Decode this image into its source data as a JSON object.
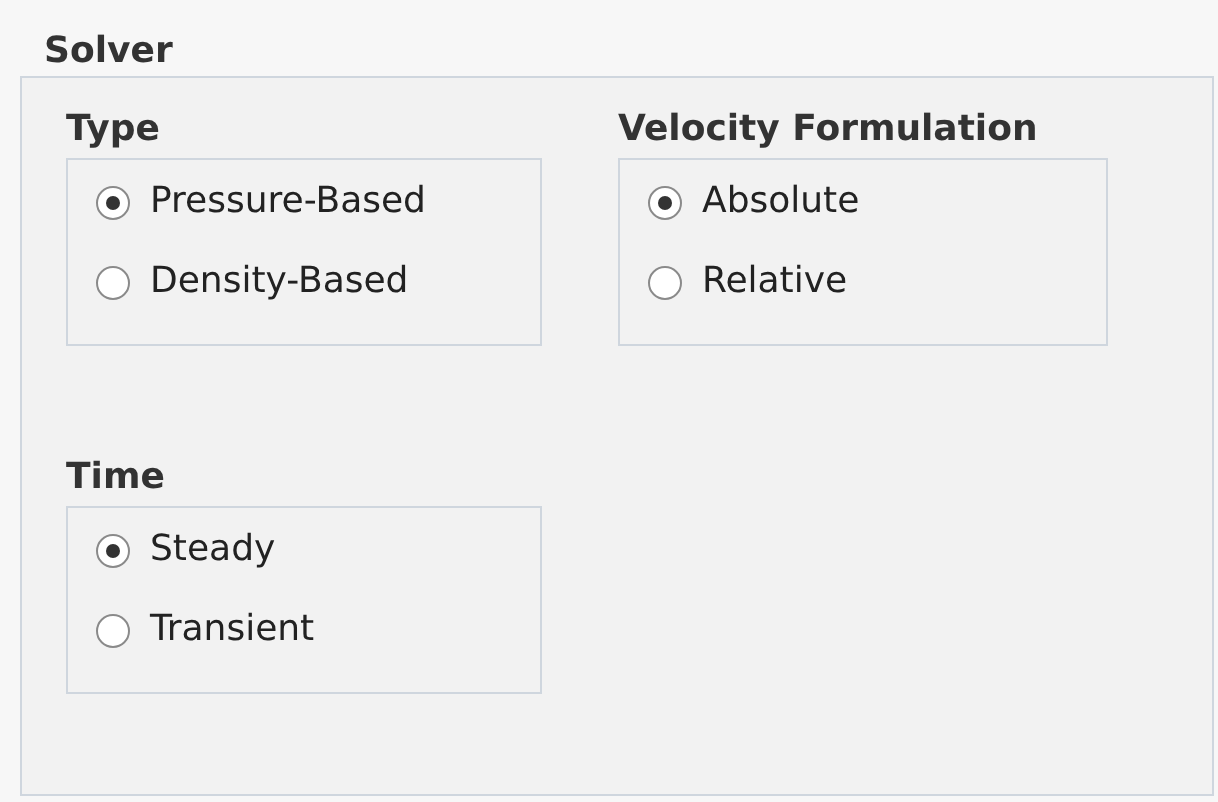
{
  "panel": {
    "title": "Solver"
  },
  "groups": [
    {
      "title": "Type",
      "options": [
        {
          "label": "Pressure-Based",
          "selected": true
        },
        {
          "label": "Density-Based",
          "selected": false
        }
      ]
    },
    {
      "title": "Velocity Formulation",
      "options": [
        {
          "label": "Absolute",
          "selected": true
        },
        {
          "label": "Relative",
          "selected": false
        }
      ]
    },
    {
      "title": "Time",
      "options": [
        {
          "label": "Steady",
          "selected": true
        },
        {
          "label": "Transient",
          "selected": false
        }
      ]
    }
  ]
}
